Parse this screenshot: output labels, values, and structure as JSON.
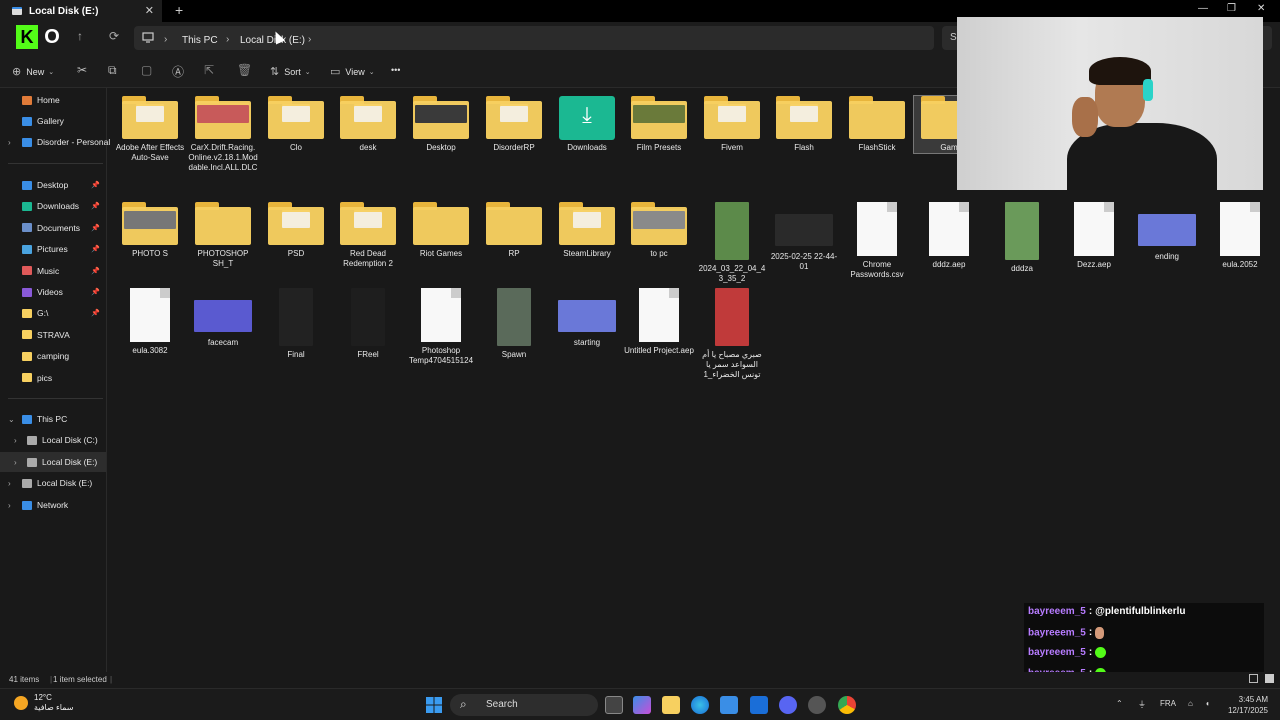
{
  "window": {
    "tab_title": "Local Disk (E:)",
    "tab_close": "✕",
    "new_tab": "+",
    "minimize": "—",
    "maximize": "❐",
    "close": "✕"
  },
  "nav": {
    "back": "←",
    "up": "↑",
    "refresh": "⟳",
    "logo_k": "K",
    "logo_o": "O"
  },
  "breadcrumb": [
    {
      "label": "This PC"
    },
    {
      "label": "Local Disk (E:)"
    }
  ],
  "search": {
    "placeholder": "S"
  },
  "toolbar": {
    "new_label": "New",
    "sort_label": "Sort",
    "view_label": "View",
    "more": "•••"
  },
  "sidebar": {
    "quick": [
      {
        "label": "Home",
        "icon": "home-icon",
        "color": "#e07b39"
      },
      {
        "label": "Gallery",
        "icon": "gallery-icon",
        "color": "#3a8ee6"
      },
      {
        "label": "Disorder - Personal",
        "icon": "cloud-icon",
        "color": "#3a8ee6"
      }
    ],
    "pinned": [
      {
        "label": "Desktop",
        "icon": "desktop-icon",
        "color": "#3a8ee6",
        "pinned": true
      },
      {
        "label": "Downloads",
        "icon": "download-icon",
        "color": "#1bb892",
        "pinned": true
      },
      {
        "label": "Documents",
        "icon": "documents-icon",
        "color": "#6b8fc9",
        "pinned": true
      },
      {
        "label": "Pictures",
        "icon": "pictures-icon",
        "color": "#4aa3df",
        "pinned": true
      },
      {
        "label": "Music",
        "icon": "music-icon",
        "color": "#e05a5a",
        "pinned": true
      },
      {
        "label": "Videos",
        "icon": "videos-icon",
        "color": "#8a5ad9",
        "pinned": true
      },
      {
        "label": "G:\\",
        "icon": "drive-icon",
        "color": "#f7d060",
        "pinned": true
      },
      {
        "label": "STRAVA",
        "icon": "folder-icon",
        "color": "#f7d060",
        "pinned": false
      },
      {
        "label": "camping",
        "icon": "folder-icon",
        "color": "#f7d060",
        "pinned": false
      },
      {
        "label": "pics",
        "icon": "folder-icon",
        "color": "#f7d060",
        "pinned": false
      }
    ],
    "tree": [
      {
        "label": "This PC",
        "icon": "pc-icon",
        "color": "#3a8ee6"
      },
      {
        "label": "Local Disk (C:)",
        "icon": "drive-icon",
        "color": "#aaa"
      },
      {
        "label": "Local Disk (E:)",
        "icon": "drive-icon",
        "color": "#aaa"
      },
      {
        "label": "Local Disk (E:)",
        "icon": "drive-icon",
        "color": "#aaa"
      },
      {
        "label": "Network",
        "icon": "network-icon",
        "color": "#3a8ee6"
      }
    ]
  },
  "files": [
    {
      "name": "Adobe After Effects Auto-Save",
      "kind": "folder",
      "thumb": ""
    },
    {
      "name": "CarX.Drift.Racing.Online.v2.18.1.Moddable.Incl.ALL.DLC",
      "kind": "folder",
      "thumb": "#c85a5a"
    },
    {
      "name": "Clo",
      "kind": "folder",
      "thumb": ""
    },
    {
      "name": "desk",
      "kind": "folder",
      "thumb": ""
    },
    {
      "name": "Desktop",
      "kind": "folder",
      "thumb": "#3a3a3a"
    },
    {
      "name": "DisorderRP",
      "kind": "folder",
      "thumb": ""
    },
    {
      "name": "Downloads",
      "kind": "downloads",
      "thumb": ""
    },
    {
      "name": "Film Presets",
      "kind": "folder",
      "thumb": "#6a7a3a"
    },
    {
      "name": "Fivem",
      "kind": "folder",
      "thumb": ""
    },
    {
      "name": "Flash",
      "kind": "folder",
      "thumb": ""
    },
    {
      "name": "FlashStick",
      "kind": "folder",
      "thumb": "none"
    },
    {
      "name": "Gam",
      "kind": "folder",
      "thumb": "none"
    },
    {
      "name": "PHOTO S",
      "kind": "folder",
      "thumb": "#777"
    },
    {
      "name": "PHOTOSHOP SH_T",
      "kind": "folder",
      "thumb": "none"
    },
    {
      "name": "PSD",
      "kind": "folder",
      "thumb": ""
    },
    {
      "name": "Red Dead Redemption 2",
      "kind": "folder",
      "thumb": ""
    },
    {
      "name": "Riot Games",
      "kind": "folder",
      "thumb": "none"
    },
    {
      "name": "RP",
      "kind": "folder",
      "thumb": "none"
    },
    {
      "name": "SteamLibrary",
      "kind": "folder",
      "thumb": ""
    },
    {
      "name": "to pc",
      "kind": "folder",
      "thumb": "#8a8a8a"
    },
    {
      "name": "2024_03_22_04_43_35_2",
      "kind": "image",
      "thumb": "#5c8a4a"
    },
    {
      "name": "2025-02-25 22-44-01",
      "kind": "wide",
      "thumb": "#2a2a2a"
    },
    {
      "name": "Chrome Passwords.csv",
      "kind": "doc",
      "thumb": ""
    },
    {
      "name": "dddz.aep",
      "kind": "doc",
      "thumb": ""
    },
    {
      "name": "dddza",
      "kind": "image",
      "thumb": "#6a9a5a"
    },
    {
      "name": "Dezz.aep",
      "kind": "doc",
      "thumb": ""
    },
    {
      "name": "ending",
      "kind": "wide",
      "thumb": "#6a78d8"
    },
    {
      "name": "eula.2052",
      "kind": "doc",
      "thumb": ""
    },
    {
      "name": "eula.3082",
      "kind": "doc",
      "thumb": ""
    },
    {
      "name": "facecam",
      "kind": "wide",
      "thumb": "#5a5ad0"
    },
    {
      "name": "Final",
      "kind": "image",
      "thumb": "#222"
    },
    {
      "name": "FReel",
      "kind": "image",
      "thumb": "#1e1e1e"
    },
    {
      "name": "Photoshop Temp4704515124",
      "kind": "doc",
      "thumb": ""
    },
    {
      "name": "Spawn",
      "kind": "image",
      "thumb": "#5a6a5a"
    },
    {
      "name": "starting",
      "kind": "wide",
      "thumb": "#6a78d8"
    },
    {
      "name": "Untitled Project.aep",
      "kind": "doc",
      "thumb": ""
    },
    {
      "name": "صبري مصباح يا أم السواعد سمر يا تونس الخضراء_1",
      "kind": "image",
      "thumb": "#c03a3a"
    }
  ],
  "status": {
    "items": "41 items",
    "selected": "1 item selected"
  },
  "chat": [
    {
      "user": "bayreeem_5",
      "msg": "@plentifulblinkerlu",
      "emote": ""
    },
    {
      "user": "bayreeem_5",
      "msg": "",
      "emote": "face"
    },
    {
      "user": "bayreeem_5",
      "msg": "",
      "emote": "green"
    },
    {
      "user": "bayreeem_5",
      "msg": "",
      "emote": "green"
    },
    {
      "user": "bayreeem_5",
      "msg": "",
      "emote": "green"
    }
  ],
  "taskbar": {
    "temp": "12°C",
    "weather": "سماء صافية",
    "search": "Search",
    "lang": "FRA",
    "time": "3:45 AM",
    "date": "12/17/2025"
  },
  "colors": {
    "accent": "#3a8ee6",
    "kick_green": "#53fc18",
    "chat_user": "#b77cff"
  }
}
